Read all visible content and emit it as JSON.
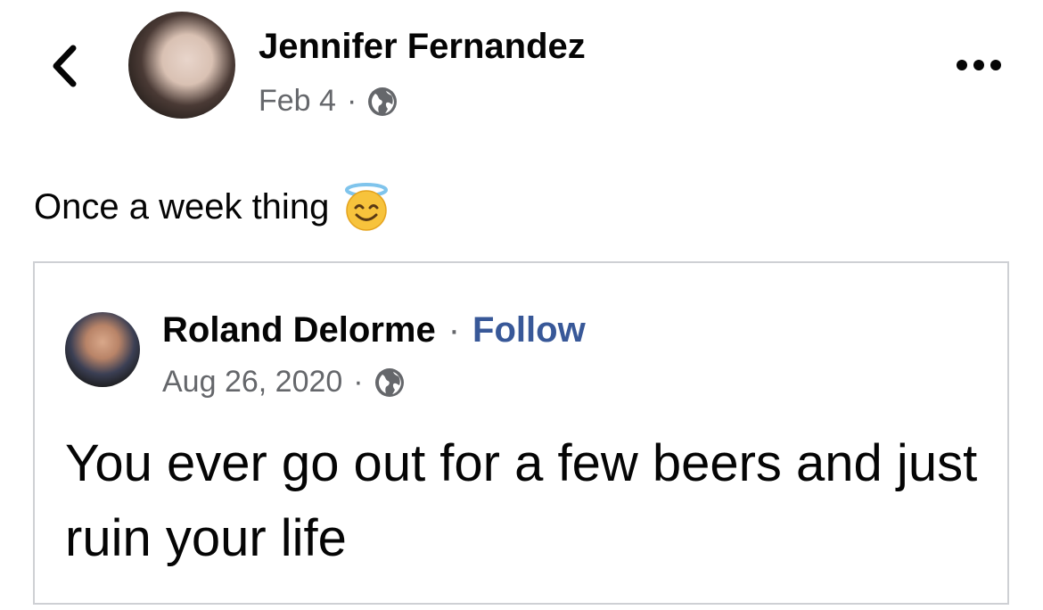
{
  "post": {
    "author": "Jennifer Fernandez",
    "date": "Feb 4",
    "separator": "·",
    "privacy_icon": "globe-icon",
    "text": "Once a week thing",
    "emoji": "smiling-face-with-halo-icon"
  },
  "shared": {
    "author": "Roland Delorme",
    "separator": "·",
    "follow_label": "Follow",
    "date": "Aug 26, 2020",
    "privacy_icon": "globe-icon",
    "text": "You ever go out for a few beers and just ruin your life"
  },
  "colors": {
    "link": "#385898",
    "meta": "#65676b",
    "border": "#ced0d4"
  }
}
